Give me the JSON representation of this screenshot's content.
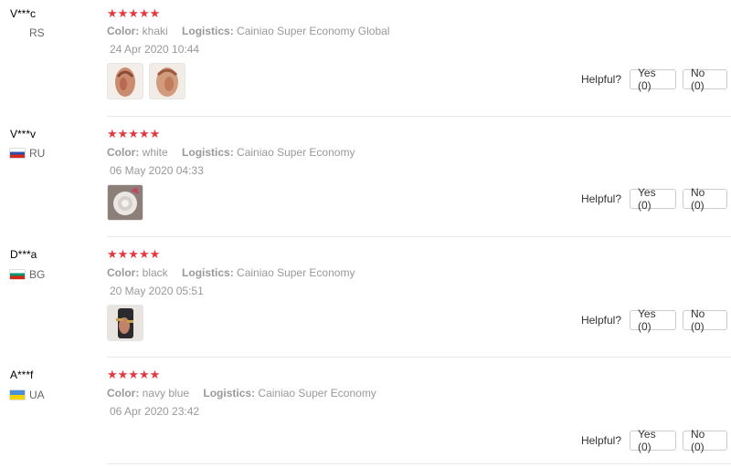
{
  "reviews": [
    {
      "user": "V***c",
      "country": "RS",
      "stars": "★★★★★",
      "color_label": "Color:",
      "color_value": "khaki",
      "logistics_label": "Logistics:",
      "logistics_value": "Cainiao Super Economy Global",
      "date": "24 Apr 2020 10:44",
      "helpful_label": "Helpful?",
      "yes_label": "Yes (0)",
      "no_label": "No (0)"
    },
    {
      "user": "V***v",
      "country": "RU",
      "stars": "★★★★★",
      "color_label": "Color:",
      "color_value": "white",
      "logistics_label": "Logistics:",
      "logistics_value": "Cainiao Super Economy",
      "date": "06 May 2020 04:33",
      "helpful_label": "Helpful?",
      "yes_label": "Yes (0)",
      "no_label": "No (0)"
    },
    {
      "user": "D***a",
      "country": "BG",
      "stars": "★★★★★",
      "color_label": "Color:",
      "color_value": "black",
      "logistics_label": "Logistics:",
      "logistics_value": "Cainiao Super Economy",
      "date": "20 May 2020 05:51",
      "helpful_label": "Helpful?",
      "yes_label": "Yes (0)",
      "no_label": "No (0)"
    },
    {
      "user": "A***f",
      "country": "UA",
      "stars": "★★★★★",
      "color_label": "Color:",
      "color_value": "navy blue",
      "logistics_label": "Logistics:",
      "logistics_value": "Cainiao Super Economy",
      "date": "06 Apr 2020 23:42",
      "helpful_label": "Helpful?",
      "yes_label": "Yes (0)",
      "no_label": "No (0)"
    }
  ],
  "colors": {
    "star": "#e5373f",
    "meta_text": "#999999",
    "divider": "#e8e8e8"
  },
  "icons": {
    "star": "star-icon",
    "flag_ru": "russia-flag-icon",
    "flag_bg": "bulgaria-flag-icon",
    "flag_ua": "ukraine-flag-icon"
  }
}
